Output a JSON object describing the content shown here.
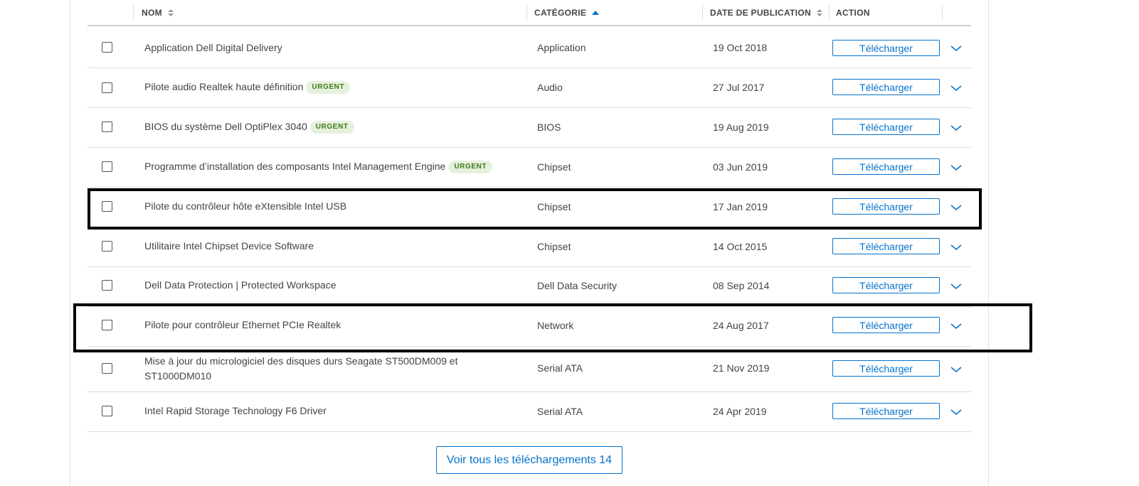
{
  "table": {
    "headers": {
      "name": "NOM",
      "category": "CATÉGORIE",
      "date": "DATE DE PUBLICATION",
      "action": "ACTION"
    },
    "rows": [
      {
        "name": "Application Dell Digital Delivery",
        "badge": "",
        "category": "Application",
        "date": "19 Oct 2018",
        "action": "Télécharger"
      },
      {
        "name": "Pilote audio Realtek haute définition",
        "badge": "URGENT",
        "category": "Audio",
        "date": "27 Jul 2017",
        "action": "Télécharger"
      },
      {
        "name": "BIOS du système Dell OptiPlex 3040",
        "badge": "URGENT",
        "category": "BIOS",
        "date": "19 Aug 2019",
        "action": "Télécharger"
      },
      {
        "name": "Programme d’installation des composants Intel Management Engine",
        "badge": "URGENT",
        "category": "Chipset",
        "date": "03 Jun 2019",
        "action": "Télécharger"
      },
      {
        "name": "Pilote du contrôleur hôte eXtensible Intel USB",
        "badge": "",
        "category": "Chipset",
        "date": "17 Jan 2019",
        "action": "Télécharger"
      },
      {
        "name": "Utilitaire Intel Chipset Device Software",
        "badge": "",
        "category": "Chipset",
        "date": "14 Oct 2015",
        "action": "Télécharger"
      },
      {
        "name": "Dell Data Protection | Protected Workspace",
        "badge": "",
        "category": "Dell Data Security",
        "date": "08 Sep 2014",
        "action": "Télécharger"
      },
      {
        "name": "Pilote pour contrôleur Ethernet PCIe Realtek",
        "badge": "",
        "category": "Network",
        "date": "24 Aug 2017",
        "action": "Télécharger"
      },
      {
        "name": "Mise à jour du micrologiciel des disques durs Seagate ST500DM009 et ST1000DM010",
        "badge": "",
        "category": "Serial ATA",
        "date": "21 Nov 2019",
        "action": "Télécharger"
      },
      {
        "name": "Intel Rapid Storage Technology F6 Driver",
        "badge": "",
        "category": "Serial ATA",
        "date": "24 Apr 2019",
        "action": "Télécharger"
      }
    ]
  },
  "footer": {
    "view_all_label": "Voir tous les téléchargements 14"
  },
  "colors": {
    "accent": "#0672cb",
    "badge_text": "#3d7a1a",
    "badge_bg": "#e6f1dd",
    "highlight": "#000000"
  },
  "icons": {
    "sort": "sort-icon",
    "sort_active": "sort-asc-icon",
    "expand": "chevron-down-icon"
  }
}
